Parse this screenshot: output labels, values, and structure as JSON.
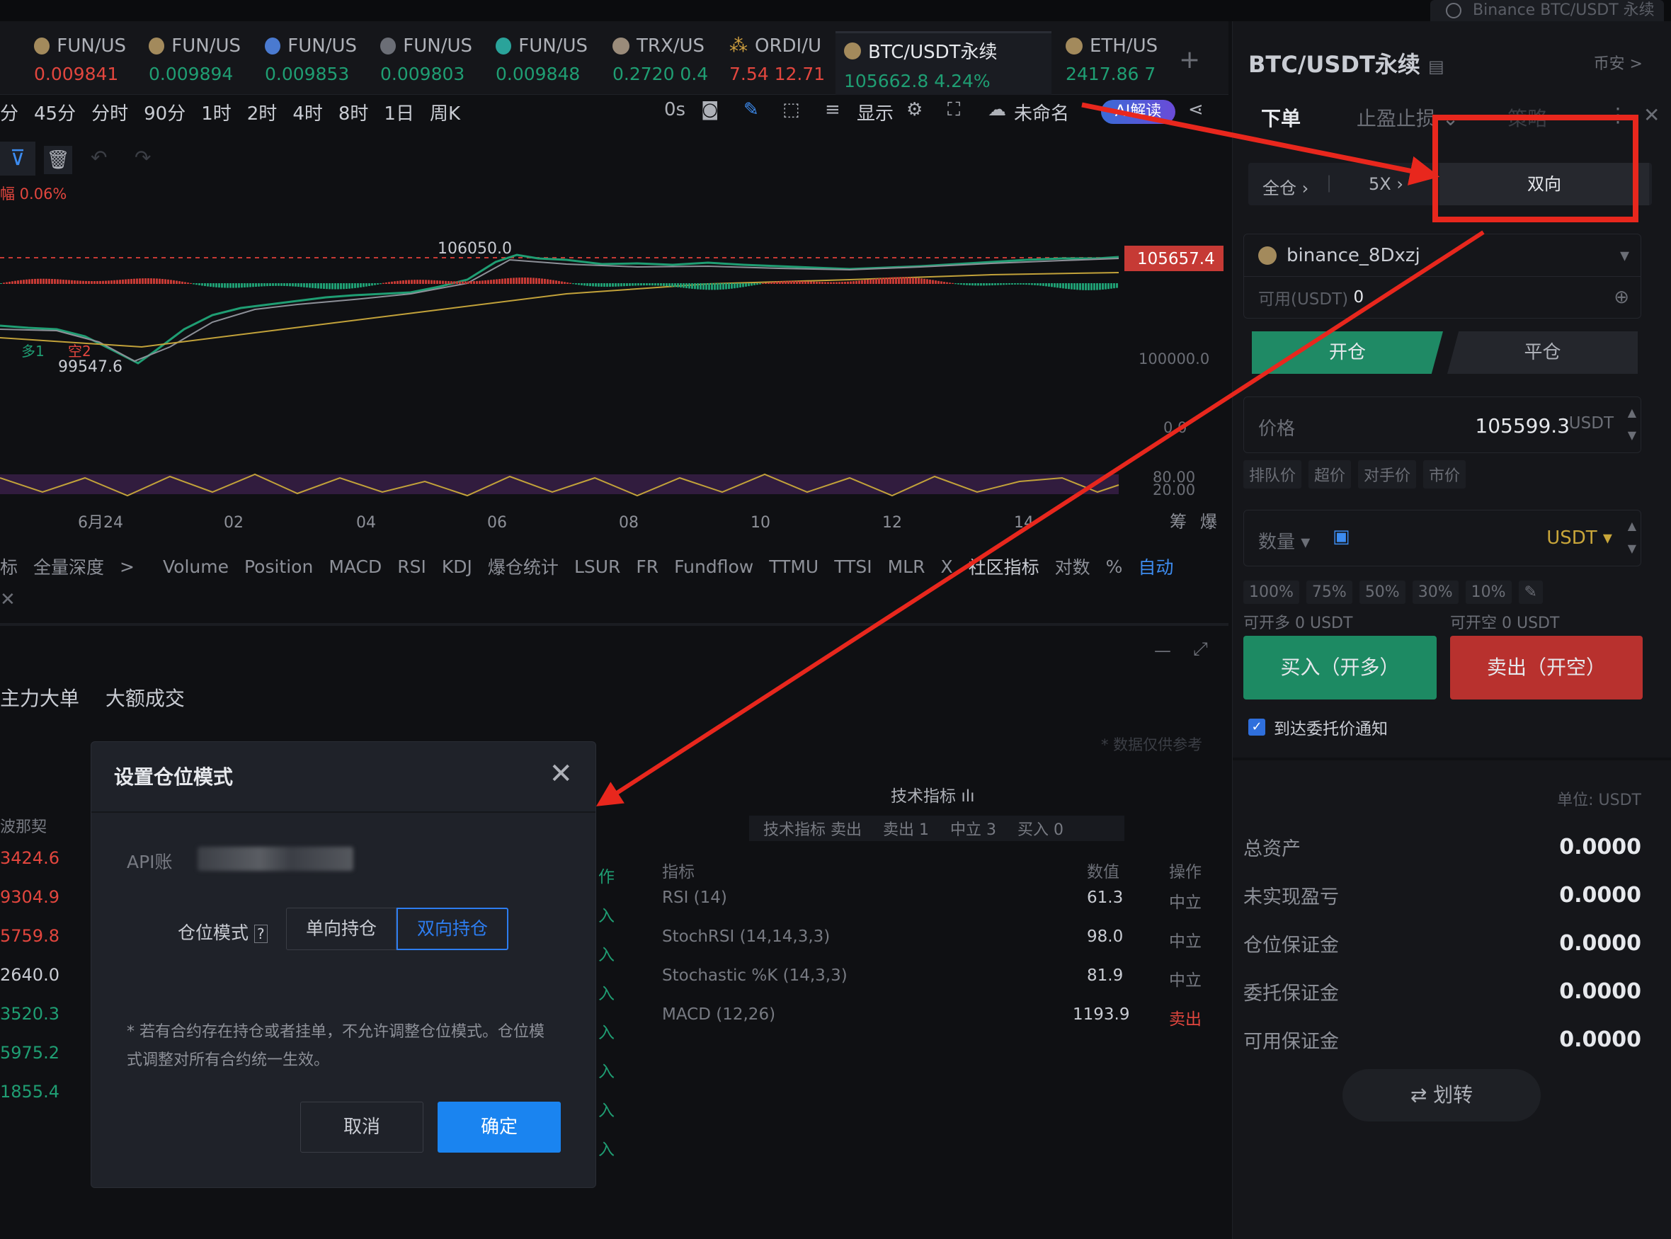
{
  "search": {
    "placeholder": "Binance BTC/USDT 永续"
  },
  "tabs": [
    {
      "name": "FUN/US",
      "price": "0.009841",
      "dir": "red"
    },
    {
      "name": "FUN/US",
      "price": "0.009894",
      "dir": "green"
    },
    {
      "name": "FUN/US",
      "price": "0.009853",
      "dir": "green"
    },
    {
      "name": "FUN/US",
      "price": "0.009803",
      "dir": "green"
    },
    {
      "name": "FUN/US",
      "price": "0.009848",
      "dir": "green"
    },
    {
      "name": "TRX/US",
      "price": "0.2720 0.4",
      "dir": "green"
    },
    {
      "name": "ORDI/U",
      "price": "7.54 12.71",
      "dir": "red"
    },
    {
      "name": "BTC/USDT永续",
      "price": "105662.8 4.24%",
      "dir": "green"
    },
    {
      "name": "ETH/US",
      "price": "2417.86 7",
      "dir": "green"
    }
  ],
  "timeframes": [
    "分",
    "45分",
    "分时",
    "90分",
    "1时",
    "2时",
    "4时",
    "8时",
    "1日",
    "周K"
  ],
  "toolbar": {
    "seconds": "0s",
    "display": "显示",
    "unnamed": "未命名",
    "ai": "AI解读"
  },
  "chart": {
    "amplitude": "幅 0.06%",
    "high_label": "106050.0",
    "low_label": "99547.6",
    "price_tag": "105657.4",
    "y_labels": [
      "100000.0",
      "0.0",
      "80.00",
      "20.00"
    ],
    "x_labels": [
      "6月24",
      "02",
      "04",
      "06",
      "08",
      "10",
      "12",
      "14"
    ],
    "right_tools": [
      "筹",
      "爆"
    ],
    "markers": [
      "多1",
      "空2"
    ]
  },
  "indicators": [
    "标",
    "全量深度",
    ">",
    "Volume",
    "Position",
    "MACD",
    "RSI",
    "KDJ",
    "爆仓统计",
    "LSUR",
    "FR",
    "Fundflow",
    "TTMU",
    "TTSI",
    "MLR",
    "X",
    "社区指标",
    "对数",
    "%",
    "自动"
  ],
  "lower_tabs": [
    "主力大单",
    "大额成交"
  ],
  "left_values": [
    "3424.6",
    "9304.9",
    "5759.8",
    "2640.0",
    "3520.3",
    "5975.2",
    "1855.4"
  ],
  "left_header": "波那契",
  "disclaimer": "* 数据仅供参考",
  "tech": {
    "title": "技术指标",
    "tags": [
      "技术指标 卖出",
      "卖出 1",
      "中立 3",
      "买入 0"
    ],
    "headers": {
      "name": "指标",
      "value": "数值",
      "action": "操作"
    },
    "rows": [
      {
        "name": "RSI (14)",
        "value": "61.3",
        "action": "中立"
      },
      {
        "name": "StochRSI (14,14,3,3)",
        "value": "98.0",
        "action": "中立"
      },
      {
        "name": "Stochastic %K (14,3,3)",
        "value": "81.9",
        "action": "中立"
      },
      {
        "name": "MACD (12,26)",
        "value": "1193.9",
        "action": "卖出"
      }
    ]
  },
  "panel": {
    "title": "BTC/USDT永续",
    "coin": "币安 >",
    "tabs": [
      "下单",
      "止盈止损 ⌄",
      "策略"
    ],
    "margin": "全仓",
    "leverage": "5X",
    "mode": "双向",
    "account": "binance_8Dxzj",
    "available_label": "可用(USDT)",
    "available": "0",
    "open": "开仓",
    "close": "平仓",
    "price_label": "价格",
    "price": "105599.3",
    "price_unit": "USDT",
    "price_chips": [
      "排队价",
      "超价",
      "对手价",
      "市价"
    ],
    "qty_label": "数量",
    "qty_unit": "USDT",
    "pct_chips": [
      "100%",
      "75%",
      "50%",
      "30%",
      "10%"
    ],
    "can_long": "可开多 0 USDT",
    "can_short": "可开空 0 USDT",
    "buy": "买入（开多）",
    "sell": "卖出（开空）",
    "notify": "到达委托价通知",
    "unit": "单位: USDT",
    "stats": [
      {
        "k": "总资产",
        "v": "0.0000"
      },
      {
        "k": "未实现盈亏",
        "v": "0.0000"
      },
      {
        "k": "仓位保证金",
        "v": "0.0000"
      },
      {
        "k": "委托保证金",
        "v": "0.0000"
      },
      {
        "k": "可用保证金",
        "v": "0.0000"
      }
    ],
    "transfer": "⇄ 划转"
  },
  "modal": {
    "title": "设置仓位模式",
    "api_label": "API账",
    "mode_label": "仓位模式",
    "one_way": "单向持仓",
    "hedge": "双向持仓",
    "note": "* 若有合约存在持仓或者挂单，不允许调整仓位模式。仓位模式调整对所有合约统一生效。",
    "cancel": "取消",
    "confirm": "确定"
  }
}
